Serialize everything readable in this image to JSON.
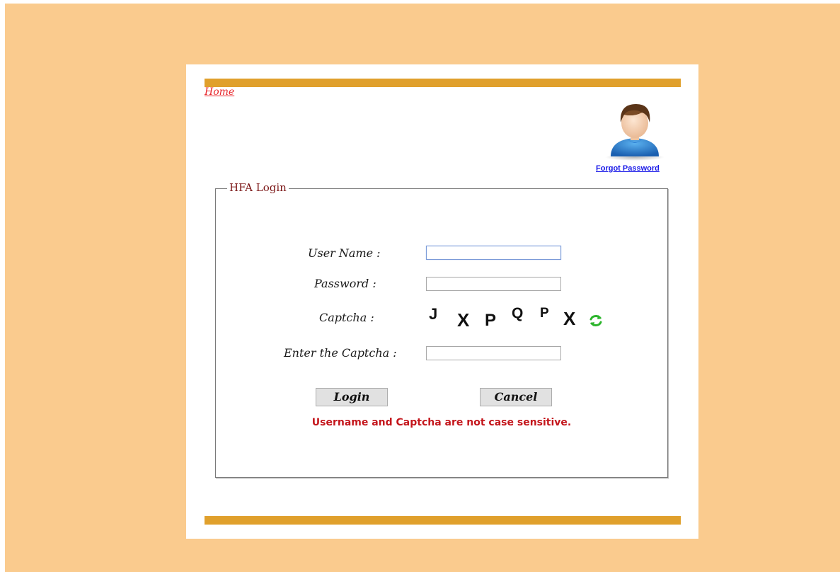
{
  "nav": {
    "home_label": "Home",
    "forgot_password_label": "Forgot Password"
  },
  "login": {
    "legend": "HFA Login",
    "username_label": "User Name :",
    "password_label": "Password :",
    "captcha_label": "Captcha :",
    "enter_captcha_label": "Enter the Captcha :",
    "username_value": "",
    "password_value": "",
    "captcha_input_value": "",
    "captcha_chars": [
      "J",
      "X",
      "P",
      "Q",
      "P",
      "X"
    ],
    "login_button": "Login",
    "cancel_button": "Cancel",
    "note": "Username and Captcha are not case sensitive."
  },
  "icons": {
    "avatar": "user-avatar-icon",
    "refresh": "refresh-captcha-icon"
  },
  "colors": {
    "background": "#facb8e",
    "accent_bar": "#e0a02c",
    "legend_text": "#7a1414",
    "note_text": "#c4161c",
    "home_link": "#e8262b",
    "forgot_link": "#1a1ae8",
    "refresh_icon": "#2db52d"
  }
}
